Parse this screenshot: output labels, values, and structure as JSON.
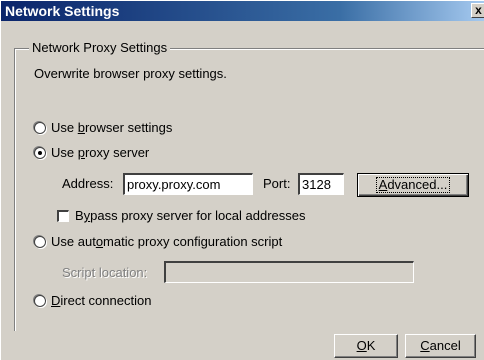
{
  "window": {
    "title": "Network Settings",
    "close_glyph": "x"
  },
  "group": {
    "legend": "Network Proxy Settings",
    "description": "Overwrite browser proxy settings."
  },
  "options": {
    "browser_settings": {
      "label_pre": "Use ",
      "label_key": "b",
      "label_post": "rowser settings",
      "checked": false
    },
    "proxy_server": {
      "label_pre": "Use ",
      "label_key": "p",
      "label_post": "roxy server",
      "checked": true
    },
    "auto_config": {
      "label_pre": "Use aut",
      "label_key": "o",
      "label_post": "matic proxy configuration script",
      "checked": false
    },
    "direct": {
      "label_pre": "",
      "label_key": "D",
      "label_post": "irect connection",
      "checked": false
    }
  },
  "proxy": {
    "address_label": "Address:",
    "address_value": "proxy.proxy.com",
    "port_label": "Port:",
    "port_value": "3128",
    "advanced_pre": "",
    "advanced_key": "A",
    "advanced_post": "dvanced..."
  },
  "bypass": {
    "label_pre": "B",
    "label_key": "y",
    "label_post": "pass proxy server for local addresses",
    "checked": false
  },
  "script": {
    "location_label": "Script location:",
    "location_value": ""
  },
  "footer": {
    "ok_key": "O",
    "ok_post": "K",
    "cancel_key": "C",
    "cancel_post": "ancel"
  }
}
